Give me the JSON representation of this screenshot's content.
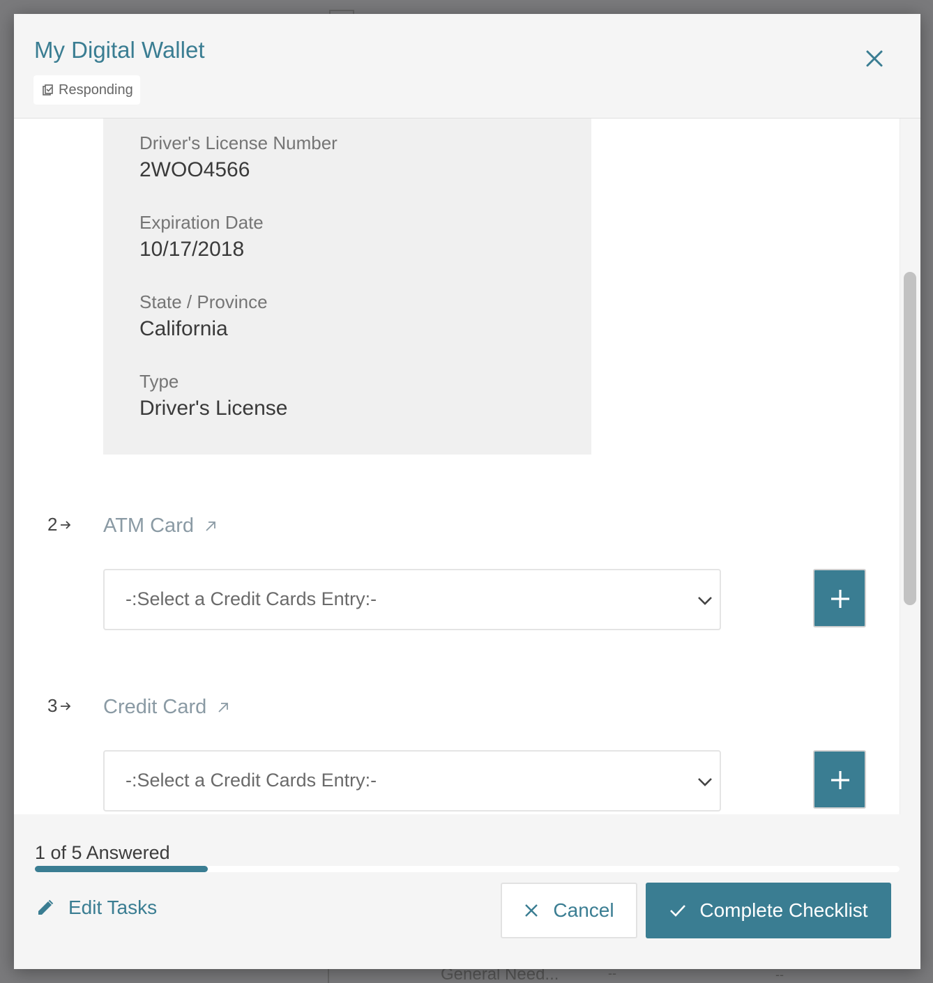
{
  "background": {
    "fragment_text": "General Need...",
    "dash_1": "--",
    "dash_2": "--"
  },
  "modal": {
    "title": "My Digital Wallet",
    "status": "Responding",
    "close_icon": "close-icon"
  },
  "record": {
    "fields": [
      {
        "label": "Driver's License Number",
        "value": "2WOO4566"
      },
      {
        "label": "Expiration Date",
        "value": "10/17/2018"
      },
      {
        "label": "State / Province",
        "value": "California"
      },
      {
        "label": "Type",
        "value": "Driver's License"
      }
    ]
  },
  "tasks": [
    {
      "number": "2",
      "title": "ATM Card",
      "select_value": "-:Select a Credit Cards Entry:-"
    },
    {
      "number": "3",
      "title": "Credit Card",
      "select_value": "-:Select a Credit Cards Entry:-"
    }
  ],
  "footer": {
    "progress_text": "1 of 5 Answered",
    "progress_fraction": 0.2,
    "edit_tasks_label": "Edit Tasks",
    "cancel_label": "Cancel",
    "complete_label": "Complete Checklist"
  },
  "colors": {
    "accent": "#3a7d92",
    "panel": "#f0f0f0",
    "overlay": "#7a7a7c"
  }
}
